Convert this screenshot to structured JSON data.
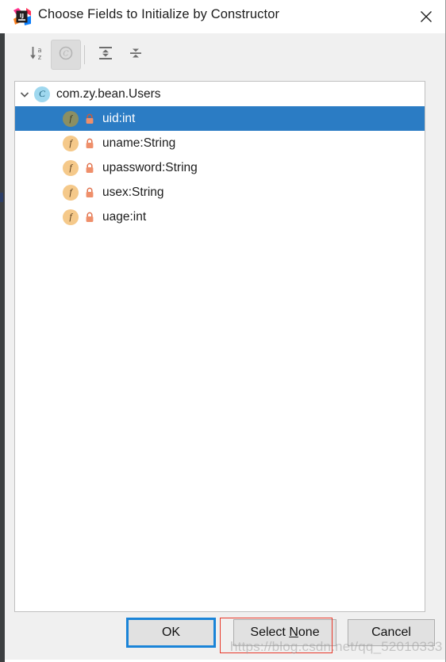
{
  "window": {
    "title": "Choose Fields to Initialize by Constructor",
    "app_icon_name": "intellij-idea-logo",
    "close_label": "✕"
  },
  "toolbar": {
    "buttons": [
      {
        "name": "sort-alphabetically-button",
        "tooltip": "Sort alphabetically",
        "icon": "sort-az-icon",
        "pressed": false
      },
      {
        "name": "group-by-class-button",
        "tooltip": "Group by class",
        "icon": "class-c-icon",
        "pressed": true
      },
      {
        "name": "expand-all-button",
        "tooltip": "Expand All",
        "icon": "expand-all-icon",
        "pressed": false
      },
      {
        "name": "collapse-all-button",
        "tooltip": "Collapse All",
        "icon": "collapse-all-icon",
        "pressed": false
      }
    ]
  },
  "tree": {
    "root": {
      "label": "com.zy.bean.Users",
      "icon": "class-icon",
      "expanded": true,
      "chevron": "chevron-down-icon"
    },
    "fields": [
      {
        "label": "uid:int",
        "icon": "field-icon",
        "modifier_icon": "lock-icon",
        "selected": true
      },
      {
        "label": "uname:String",
        "icon": "field-icon",
        "modifier_icon": "lock-icon",
        "selected": false
      },
      {
        "label": "upassword:String",
        "icon": "field-icon",
        "modifier_icon": "lock-icon",
        "selected": false
      },
      {
        "label": "usex:String",
        "icon": "field-icon",
        "modifier_icon": "lock-icon",
        "selected": false
      },
      {
        "label": "uage:int",
        "icon": "field-icon",
        "modifier_icon": "lock-icon",
        "selected": false
      }
    ]
  },
  "buttons": {
    "ok": "OK",
    "select_none_prefix": "Select ",
    "select_none_mnemonic": "N",
    "select_none_suffix": "one",
    "cancel": "Cancel"
  },
  "annotation": {
    "highlight_color": "#e8392a",
    "target": "Select None"
  },
  "watermark": {
    "text": "https://blog.csdn.net/qq_52010333"
  },
  "colors": {
    "selection_blue": "#2b7cc4",
    "focus_blue": "#1a84d8",
    "dialog_bg": "#f0f0f0",
    "panel_bg": "#ffffff",
    "field_icon": "#f5c98a",
    "class_icon": "#9fd8ef",
    "lock_icon": "#ef8f6a"
  }
}
